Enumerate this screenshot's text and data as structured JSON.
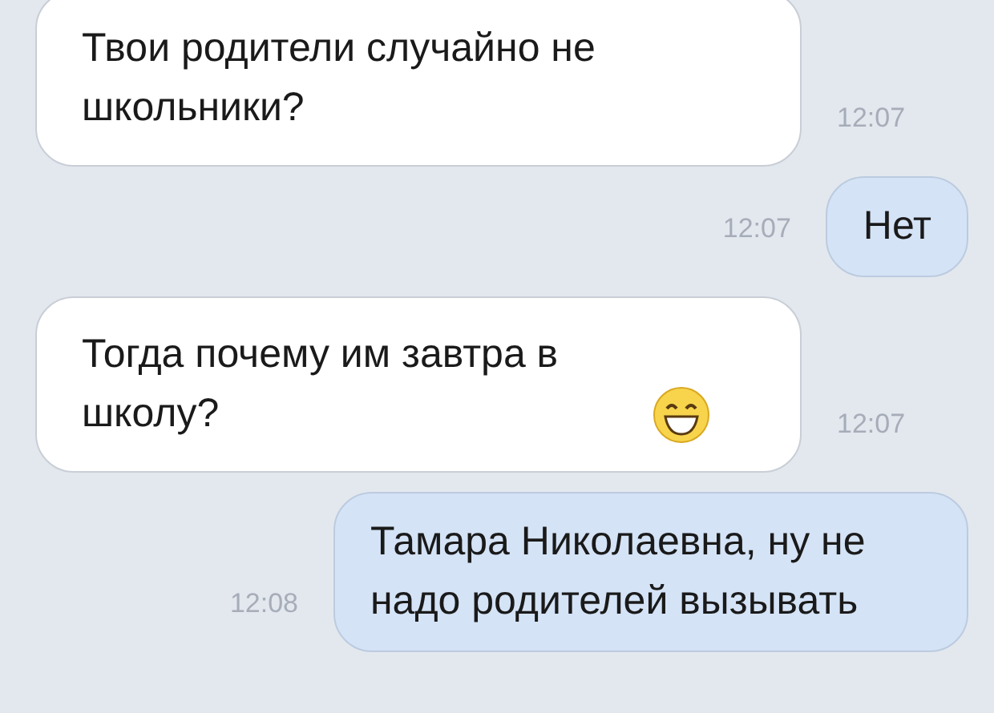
{
  "messages": [
    {
      "kind": "incoming",
      "text": "Твои родители случайно не школьники?",
      "time": "12:07",
      "emoji": false
    },
    {
      "kind": "outgoing",
      "text": "Нет",
      "time": "12:07",
      "emoji": false
    },
    {
      "kind": "incoming",
      "text": "Тогда почему им завтра в школу?",
      "time": "12:07",
      "emoji": true
    },
    {
      "kind": "outgoing",
      "text": "Тамара Николаевна, ну не надо родителей вызывать",
      "time": "12:08",
      "emoji": false
    }
  ]
}
